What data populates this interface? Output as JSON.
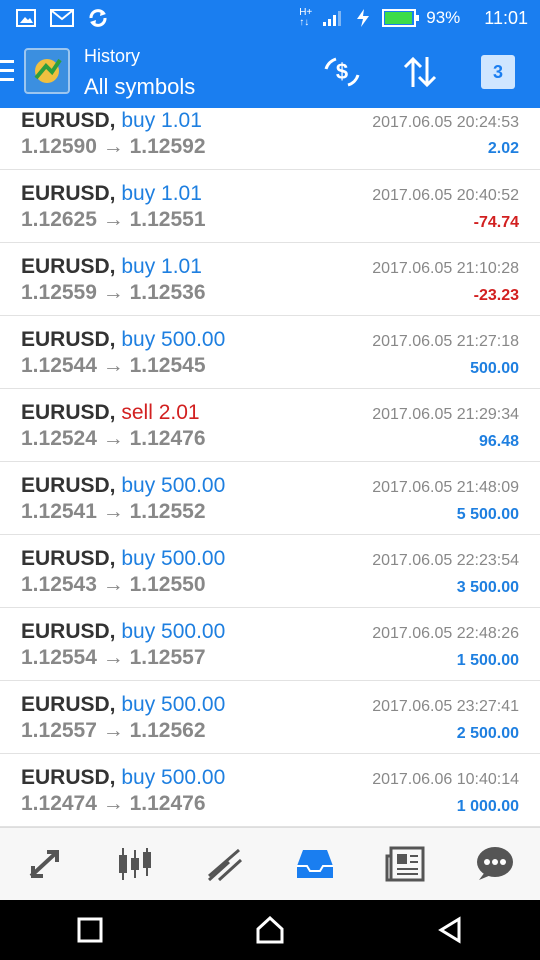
{
  "status": {
    "battery": "93%",
    "time": "11:01"
  },
  "header": {
    "section": "History",
    "filter": "All symbols",
    "calendar_day": "3"
  },
  "trades": [
    {
      "symbol": "EURUSD,",
      "type": "buy 1.01",
      "side": "buy",
      "open": "1.12590",
      "close": "1.12592",
      "time": "2017.06.05 20:24:53",
      "profit": "2.02",
      "sign": "pos"
    },
    {
      "symbol": "EURUSD,",
      "type": "buy 1.01",
      "side": "buy",
      "open": "1.12625",
      "close": "1.12551",
      "time": "2017.06.05 20:40:52",
      "profit": "-74.74",
      "sign": "neg"
    },
    {
      "symbol": "EURUSD,",
      "type": "buy 1.01",
      "side": "buy",
      "open": "1.12559",
      "close": "1.12536",
      "time": "2017.06.05 21:10:28",
      "profit": "-23.23",
      "sign": "neg"
    },
    {
      "symbol": "EURUSD,",
      "type": "buy 500.00",
      "side": "buy",
      "open": "1.12544",
      "close": "1.12545",
      "time": "2017.06.05 21:27:18",
      "profit": "500.00",
      "sign": "pos"
    },
    {
      "symbol": "EURUSD,",
      "type": "sell 2.01",
      "side": "sell",
      "open": "1.12524",
      "close": "1.12476",
      "time": "2017.06.05 21:29:34",
      "profit": "96.48",
      "sign": "pos"
    },
    {
      "symbol": "EURUSD,",
      "type": "buy 500.00",
      "side": "buy",
      "open": "1.12541",
      "close": "1.12552",
      "time": "2017.06.05 21:48:09",
      "profit": "5 500.00",
      "sign": "pos"
    },
    {
      "symbol": "EURUSD,",
      "type": "buy 500.00",
      "side": "buy",
      "open": "1.12543",
      "close": "1.12550",
      "time": "2017.06.05 22:23:54",
      "profit": "3 500.00",
      "sign": "pos"
    },
    {
      "symbol": "EURUSD,",
      "type": "buy 500.00",
      "side": "buy",
      "open": "1.12554",
      "close": "1.12557",
      "time": "2017.06.05 22:48:26",
      "profit": "1 500.00",
      "sign": "pos"
    },
    {
      "symbol": "EURUSD,",
      "type": "buy 500.00",
      "side": "buy",
      "open": "1.12557",
      "close": "1.12562",
      "time": "2017.06.05 23:27:41",
      "profit": "2 500.00",
      "sign": "pos"
    },
    {
      "symbol": "EURUSD,",
      "type": "buy 500.00",
      "side": "buy",
      "open": "1.12474",
      "close": "1.12476",
      "time": "2017.06.06 10:40:14",
      "profit": "1 000.00",
      "sign": "pos"
    }
  ],
  "arrow": "→",
  "bottom_nav": [
    "quotes-icon",
    "chart-candles-icon",
    "trade-icon",
    "history-inbox-icon",
    "news-icon",
    "chat-icon"
  ],
  "active_tab": "history-inbox-icon",
  "colors": {
    "accent": "#1a7ef0",
    "positive": "#1e7fe0",
    "negative": "#d22020"
  }
}
